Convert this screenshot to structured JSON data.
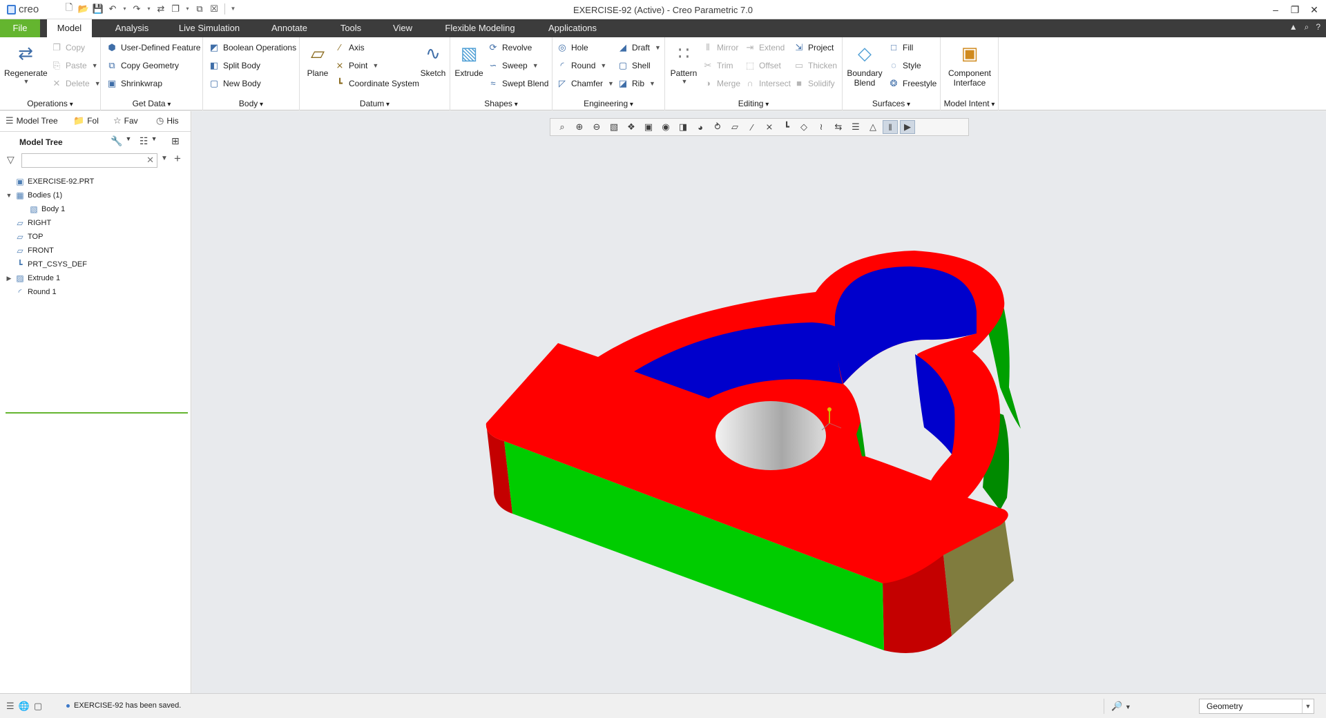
{
  "app": {
    "logo_text": "creo",
    "window_title": "EXERCISE-92 (Active) - Creo Parametric 7.0",
    "window_controls": [
      "–",
      "❐",
      "✕"
    ]
  },
  "menu_tabs": {
    "file": "File",
    "model": "Model",
    "analysis": "Analysis",
    "live_simulation": "Live Simulation",
    "annotate": "Annotate",
    "tools": "Tools",
    "view": "View",
    "flexible_modeling": "Flexible Modeling",
    "applications": "Applications",
    "active": "Model"
  },
  "ribbon": {
    "operations": {
      "label": "Operations",
      "regenerate": "Regenerate",
      "copy": "Copy",
      "paste": "Paste",
      "delete": "Delete"
    },
    "get_data": {
      "label": "Get Data",
      "user_defined_feature": "User-Defined Feature",
      "copy_geometry": "Copy Geometry",
      "shrinkwrap": "Shrinkwrap"
    },
    "body": {
      "label": "Body",
      "boolean_operations": "Boolean Operations",
      "split_body": "Split Body",
      "new_body": "New Body"
    },
    "datum": {
      "label": "Datum",
      "plane": "Plane",
      "axis": "Axis",
      "point": "Point",
      "coordinate_system": "Coordinate System",
      "sketch": "Sketch"
    },
    "shapes": {
      "label": "Shapes",
      "extrude": "Extrude",
      "revolve": "Revolve",
      "sweep": "Sweep",
      "swept_blend": "Swept Blend"
    },
    "engineering": {
      "label": "Engineering",
      "hole": "Hole",
      "round": "Round",
      "chamfer": "Chamfer",
      "draft": "Draft",
      "shell": "Shell",
      "rib": "Rib"
    },
    "editing": {
      "label": "Editing",
      "pattern": "Pattern",
      "mirror": "Mirror",
      "trim": "Trim",
      "merge": "Merge",
      "extend": "Extend",
      "offset": "Offset",
      "intersect": "Intersect",
      "project": "Project",
      "thicken": "Thicken",
      "solidify": "Solidify"
    },
    "surfaces": {
      "label": "Surfaces",
      "boundary_blend_1": "Boundary",
      "boundary_blend_2": "Blend",
      "fill": "Fill",
      "style": "Style",
      "freestyle": "Freestyle"
    },
    "model_intent": {
      "label": "Model Intent",
      "component_interface_1": "Component",
      "component_interface_2": "Interface"
    }
  },
  "navigator": {
    "tabs": [
      "Model Tree",
      "Folder Browser",
      "Favorites",
      "History"
    ],
    "tab_visible_text": [
      "Model Tree",
      "Fol",
      "Fav",
      "His"
    ],
    "header": "Model Tree",
    "search_placeholder": "",
    "tree": [
      {
        "label": "EXERCISE-92.PRT",
        "icon": "part-icon",
        "indent": 0,
        "toggle": ""
      },
      {
        "label": "Bodies (1)",
        "icon": "bodies-icon",
        "indent": 0,
        "toggle": "▼"
      },
      {
        "label": "Body 1",
        "icon": "body-icon",
        "indent": 1,
        "toggle": ""
      },
      {
        "label": "RIGHT",
        "icon": "datum-plane-icon",
        "indent": 0,
        "toggle": ""
      },
      {
        "label": "TOP",
        "icon": "datum-plane-icon",
        "indent": 0,
        "toggle": ""
      },
      {
        "label": "FRONT",
        "icon": "datum-plane-icon",
        "indent": 0,
        "toggle": ""
      },
      {
        "label": "PRT_CSYS_DEF",
        "icon": "csys-icon",
        "indent": 0,
        "toggle": ""
      },
      {
        "label": "Extrude 1",
        "icon": "extrude-icon",
        "indent": 0,
        "toggle": "▶"
      },
      {
        "label": "Round 1",
        "icon": "round-icon",
        "indent": 0,
        "toggle": ""
      }
    ]
  },
  "graphics_toolbar": {
    "icons": [
      "refit-icon",
      "zoom-in-icon",
      "zoom-out-icon",
      "repaint-icon",
      "view-manager-icon",
      "saved-orientations-icon",
      "display-style-icon",
      "section-icon",
      "appearance-icon",
      "spin-center-icon",
      "plane-display-icon",
      "axis-display-icon",
      "point-display-icon",
      "csys-display-icon",
      "annotation-display-icon",
      "sketch-display-icon",
      "toggle-display-icon",
      "datum-filter-icon",
      "perspective-icon",
      "pause-icon",
      "animation-icon"
    ],
    "active": [
      19,
      20
    ]
  },
  "model_colors": {
    "top_face": "#ff0000",
    "front_face": "#00cc00",
    "inner_face": "#0000cc",
    "side_green": "#00a800",
    "end_face": "#807c3e",
    "hole_face": "#b8b8b8",
    "background": "#e8eaed"
  },
  "status": {
    "message": "EXERCISE-92 has been saved.",
    "selection_filter": "Geometry"
  }
}
